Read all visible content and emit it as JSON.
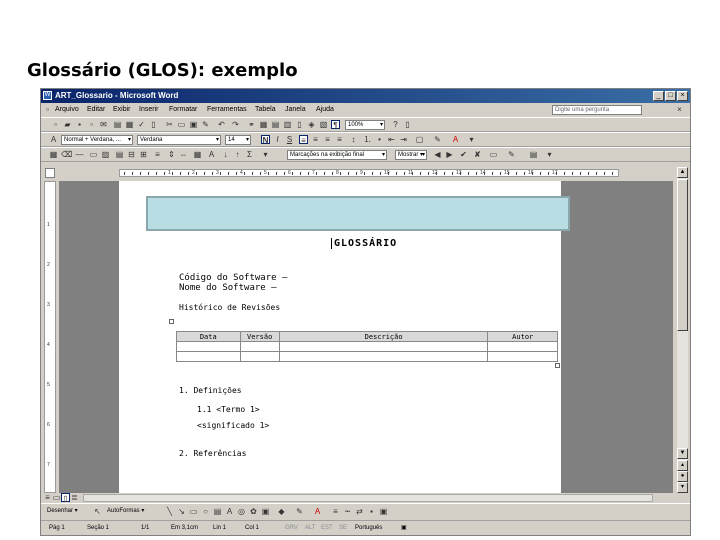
{
  "slide": {
    "title": "Glossário (GLOS): exemplo"
  },
  "window": {
    "title": "ART_Glossario - Microsoft Word",
    "controls": [
      "_",
      "□",
      "×"
    ]
  },
  "menu": {
    "items": [
      "Arquivo",
      "Editar",
      "Exibir",
      "Inserir",
      "Formatar",
      "Ferramentas",
      "Tabela",
      "Janela",
      "Ajuda"
    ],
    "help_placeholder": "Digite uma pergunta"
  },
  "toolbar": {
    "zoom": "100%",
    "style": "Normal + Verdana, ...",
    "font": "Verdana",
    "size": "14",
    "bold": "N",
    "reviewing_view": "Marcações na exibição final",
    "show_button": "Mostrar ▾"
  },
  "ruler": {
    "numbers": [
      "1",
      "2",
      "3",
      "4",
      "5",
      "6",
      "7",
      "8",
      "9",
      "10",
      "11",
      "12",
      "13",
      "14",
      "15",
      "16",
      "17"
    ]
  },
  "document": {
    "heading": "GLOSSÁRIO",
    "line1": "Código do Software –",
    "line2": "Nome do Software –",
    "revisions_heading": "Histórico de Revisões",
    "table": {
      "headers": [
        "Data",
        "Versão",
        "Descrição",
        "Autor"
      ],
      "rows": [
        [
          "",
          "",
          "",
          ""
        ],
        [
          "",
          "",
          "",
          ""
        ]
      ]
    },
    "section1": "1. Definições",
    "term": "1.1 <Termo 1>",
    "meaning": "<significado 1>",
    "section2": "2. Referências"
  },
  "drawbar": {
    "draw": "Desenhar ▾",
    "autoshapes": "AutoFormas ▾"
  },
  "status": {
    "page": "Pág 1",
    "section": "Seção 1",
    "pages": "1/1",
    "at": "Em 3,1cm",
    "line": "Lin 1",
    "col": "Col 1",
    "modes": [
      "GRV",
      "ALT",
      "EST",
      "SE"
    ],
    "language": "Português"
  }
}
